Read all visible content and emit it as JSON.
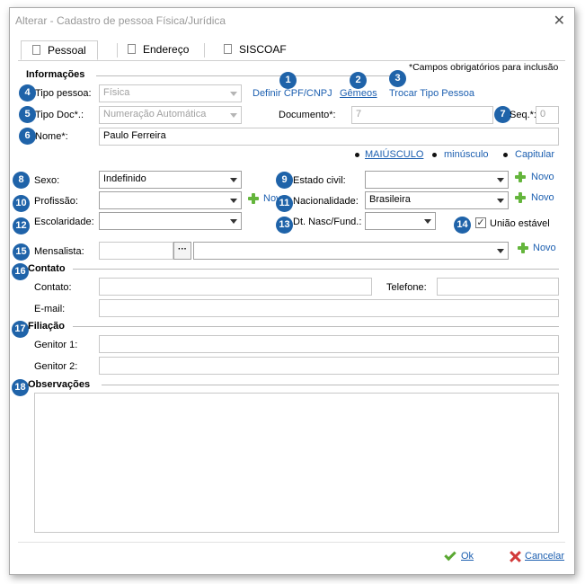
{
  "window": {
    "title": "Alterar - Cadastro de pessoa Física/Jurídica",
    "close_glyph": "✕"
  },
  "tabs": [
    {
      "label": "Pessoal",
      "active": true
    },
    {
      "label": "Endereço",
      "active": false
    },
    {
      "label": "SISCOAF",
      "active": false
    }
  ],
  "info": {
    "section": "Informações",
    "required_note": "*Campos obrigatórios para inclusão",
    "links": {
      "definir": "Definir CPF/CNPJ",
      "gemeos": "Gêmeos",
      "trocar": "Trocar Tipo Pessoa"
    },
    "tipo_pessoa_label": "Tipo pessoa:",
    "tipo_pessoa_value": "Física",
    "tipo_doc_label": "Tipo Doc*.:",
    "tipo_doc_value": "Numeração Automática",
    "documento_label": "Documento*:",
    "documento_value": "7",
    "seq_label": "Seq.*:",
    "seq_value": "0",
    "nome_label": "Nome*:",
    "nome_value": "Paulo Ferreira",
    "case_options": [
      "MAIÚSCULO",
      "minúsculo",
      "Capitular"
    ],
    "sexo_label": "Sexo:",
    "sexo_value": "Indefinido",
    "estado_civil_label": "Estado civil:",
    "estado_civil_value": "",
    "novo_label": "Novo",
    "novo_truncated": "Nov",
    "profissao_label": "Profissão:",
    "profissao_value": "",
    "nacionalidade_label": "Nacionalidade:",
    "nacionalidade_value": "Brasileira",
    "escolaridade_label": "Escolaridade:",
    "escolaridade_value": "",
    "dt_nasc_label": "Dt. Nasc/Fund.:",
    "dt_nasc_value": "",
    "uniao_label": "União estável",
    "uniao_checked": true,
    "mensalista_label": "Mensalista:",
    "dots": "···"
  },
  "contato": {
    "section": "Contato",
    "contato_label": "Contato:",
    "telefone_label": "Telefone:",
    "email_label": "E-mail:"
  },
  "filiacao": {
    "section": "Filiação",
    "genitor1_label": "Genitor 1:",
    "genitor2_label": "Genitor 2:"
  },
  "observacoes": {
    "section": "Observações"
  },
  "footer": {
    "ok": "Ok",
    "cancelar": "Cancelar"
  },
  "badges": [
    "1",
    "2",
    "3",
    "4",
    "5",
    "6",
    "7",
    "8",
    "9",
    "10",
    "11",
    "12",
    "13",
    "14",
    "15",
    "16",
    "17",
    "18"
  ],
  "colors": {
    "badge": "#1f63a9",
    "link": "#1c5fb0",
    "plus": "#64b53c",
    "cancel": "#d23a3a"
  }
}
